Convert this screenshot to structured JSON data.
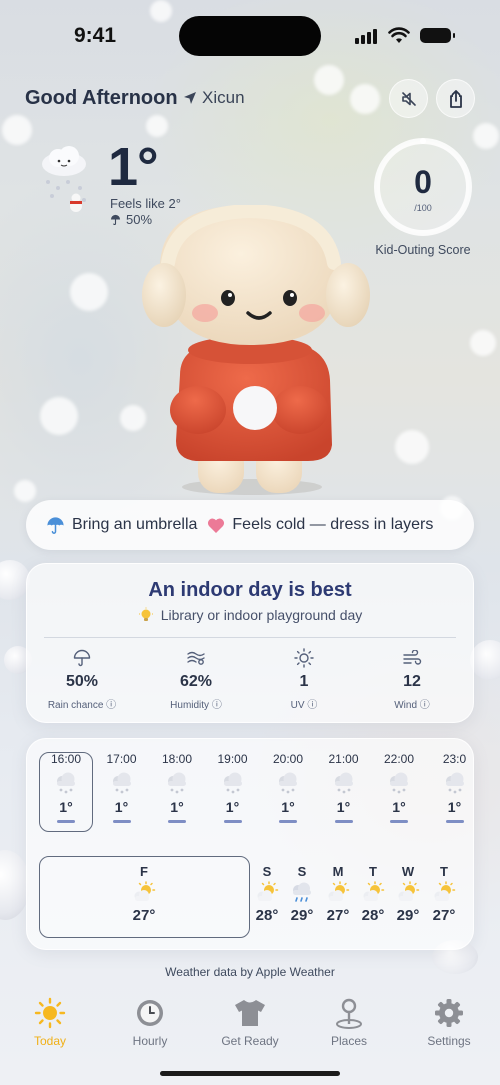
{
  "status_bar": {
    "time": "9:41"
  },
  "header": {
    "greeting": "Good Afternoon",
    "location": "Xicun"
  },
  "current": {
    "temperature": "1°",
    "feels_like": "Feels like 2°",
    "rain_chance": "50%"
  },
  "score": {
    "value": "0",
    "max": "/100",
    "label": "Kid-Outing Score",
    "fraction": 0
  },
  "tips": [
    {
      "text": "Bring an umbrella",
      "icon": "umbrella-icon"
    },
    {
      "text": "Feels cold — dress in layers",
      "icon": "heart-icon"
    }
  ],
  "recommendation": {
    "title": "An indoor day is best",
    "subtitle": "Library or indoor playground day",
    "metrics": [
      {
        "value": "50%",
        "label": "Rain chance ⓘ",
        "icon": "umbrella-icon"
      },
      {
        "value": "62%",
        "label": "Humidity ⓘ",
        "icon": "humidity-icon"
      },
      {
        "value": "1",
        "label": "UV ⓘ",
        "icon": "sun-icon"
      },
      {
        "value": "12",
        "label": "Wind ⓘ",
        "icon": "wind-icon"
      }
    ]
  },
  "hourly": [
    {
      "time": "16:00",
      "temp": "1°"
    },
    {
      "time": "17:00",
      "temp": "1°"
    },
    {
      "time": "18:00",
      "temp": "1°"
    },
    {
      "time": "19:00",
      "temp": "1°"
    },
    {
      "time": "20:00",
      "temp": "1°"
    },
    {
      "time": "21:00",
      "temp": "1°"
    },
    {
      "time": "22:00",
      "temp": "1°"
    },
    {
      "time": "23:0",
      "temp": "1°"
    }
  ],
  "daily": [
    {
      "day": "F",
      "temp": "27°",
      "icon": "partly-sunny-icon"
    },
    {
      "day": "S",
      "temp": "28°",
      "icon": "partly-sunny-icon"
    },
    {
      "day": "S",
      "temp": "29°",
      "icon": "rain-icon"
    },
    {
      "day": "M",
      "temp": "27°",
      "icon": "partly-sunny-icon"
    },
    {
      "day": "T",
      "temp": "28°",
      "icon": "partly-sunny-icon"
    },
    {
      "day": "W",
      "temp": "29°",
      "icon": "partly-sunny-icon"
    },
    {
      "day": "T",
      "temp": "27°",
      "icon": "partly-sunny-icon"
    }
  ],
  "attribution": "Weather data by Apple Weather",
  "tabs": [
    {
      "label": "Today",
      "icon": "sun-icon",
      "active": true
    },
    {
      "label": "Hourly",
      "icon": "clock-icon",
      "active": false
    },
    {
      "label": "Get Ready",
      "icon": "tshirt-icon",
      "active": false
    },
    {
      "label": "Places",
      "icon": "map-pin-icon",
      "active": false
    },
    {
      "label": "Settings",
      "icon": "gear-icon",
      "active": false
    }
  ],
  "colors": {
    "accent": "#f0b018",
    "title": "#2d3a73",
    "bar": "#7e8ec4"
  }
}
